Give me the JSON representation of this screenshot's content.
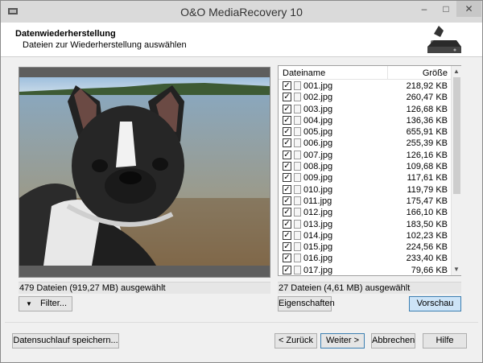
{
  "window": {
    "title": "O&O MediaRecovery 10"
  },
  "header": {
    "title": "Datenwiederherstellung",
    "subtitle": "Dateien zur Wiederherstellung auswählen"
  },
  "filelist": {
    "col_name": "Dateiname",
    "col_size": "Größe",
    "rows": [
      {
        "name": "001.jpg",
        "size": "218,92 KB"
      },
      {
        "name": "002.jpg",
        "size": "260,47 KB"
      },
      {
        "name": "003.jpg",
        "size": "126,68 KB"
      },
      {
        "name": "004.jpg",
        "size": "136,36 KB"
      },
      {
        "name": "005.jpg",
        "size": "655,91 KB"
      },
      {
        "name": "006.jpg",
        "size": "255,39 KB"
      },
      {
        "name": "007.jpg",
        "size": "126,16 KB"
      },
      {
        "name": "008.jpg",
        "size": "109,68 KB"
      },
      {
        "name": "009.jpg",
        "size": "117,61 KB"
      },
      {
        "name": "010.jpg",
        "size": "119,79 KB"
      },
      {
        "name": "011.jpg",
        "size": "175,47 KB"
      },
      {
        "name": "012.jpg",
        "size": "166,10 KB"
      },
      {
        "name": "013.jpg",
        "size": "183,50 KB"
      },
      {
        "name": "014.jpg",
        "size": "102,23 KB"
      },
      {
        "name": "015.jpg",
        "size": "224,56 KB"
      },
      {
        "name": "016.jpg",
        "size": "233,40 KB"
      },
      {
        "name": "017.jpg",
        "size": "79,66 KB"
      }
    ]
  },
  "status": {
    "left": "479 Dateien (919,27 MB) ausgewählt",
    "right": "27 Dateien (4,61 MB) ausgewählt"
  },
  "buttons": {
    "filter": "Filter...",
    "properties": "Eigenschaften",
    "preview": "Vorschau",
    "save_scan": "Datensuchlauf speichern...",
    "back": "< Zurück",
    "next": "Weiter >",
    "cancel": "Abbrechen",
    "help": "Hilfe"
  }
}
